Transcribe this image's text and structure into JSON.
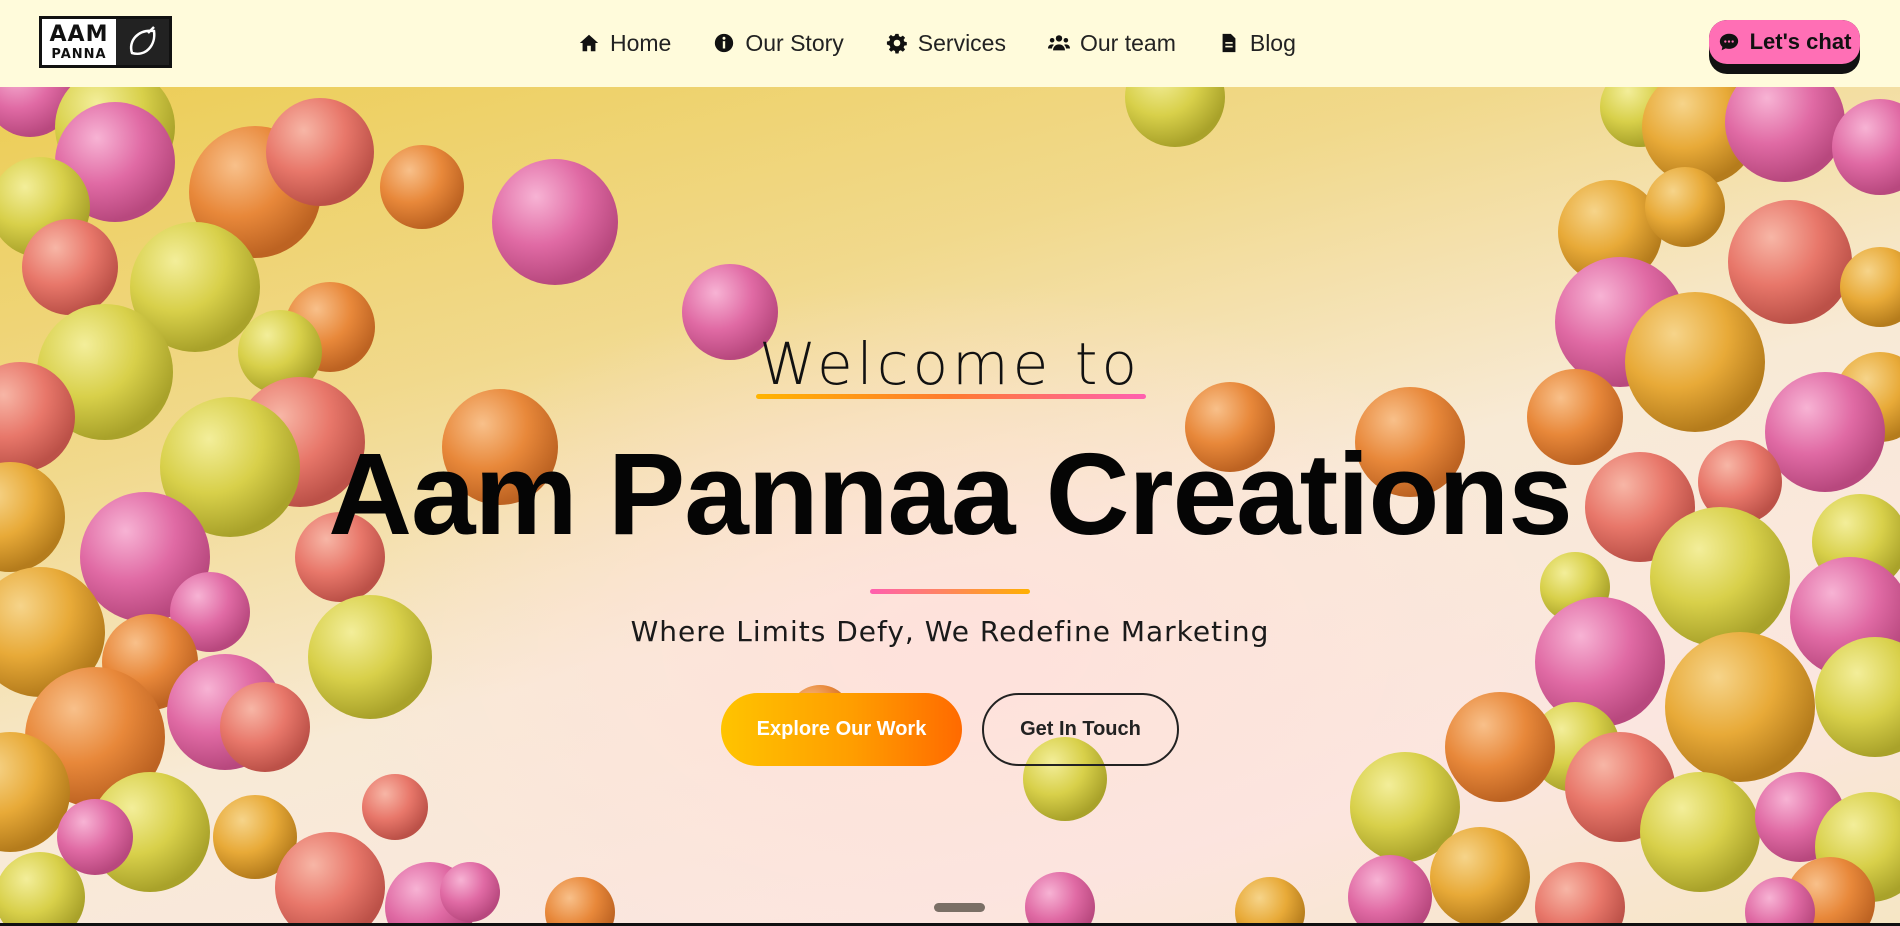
{
  "logo": {
    "line1": "AAM",
    "line2": "PANNA",
    "icon": "mango-leaf-icon"
  },
  "nav": {
    "items": [
      {
        "label": "Home",
        "icon": "home-icon"
      },
      {
        "label": "Our Story",
        "icon": "info-icon"
      },
      {
        "label": "Services",
        "icon": "gear-icon"
      },
      {
        "label": "Our team",
        "icon": "team-icon"
      },
      {
        "label": "Blog",
        "icon": "document-icon"
      }
    ],
    "chat_button": {
      "label": "Let's chat",
      "icon": "chat-bubble-icon"
    }
  },
  "hero": {
    "welcome": "Welcome to",
    "title": "Aam Pannaa Creations",
    "tagline": "Where Limits Defy, We Redefine Marketing",
    "primary_cta": "Explore Our Work",
    "secondary_cta": "Get In Touch"
  },
  "colors": {
    "nav_background": "#fffbdb",
    "chat_button": "#ff6fb5",
    "primary_cta_start": "#ffc400",
    "primary_cta_end": "#ff6a00",
    "balloon_pink": "#e06aa4",
    "balloon_orange": "#e8883a",
    "balloon_yellow": "#d8d04a",
    "balloon_coral": "#e8776a",
    "balloon_gold": "#e8aa38"
  }
}
